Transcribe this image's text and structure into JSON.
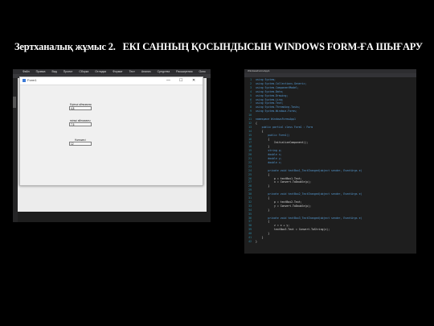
{
  "slide_title": {
    "lab": "Зертханалық жұмыс 2.",
    "main": "ЕКІ САННЫҢ ҚОСЫНДЫСЫН WINDOWS FORM-ҒА ШЫҒАРУ"
  },
  "vs_menu": [
    "Файл",
    "Правка",
    "Вид",
    "Проект",
    "Сборка",
    "Отладка",
    "Формат",
    "Тест",
    "Анализ",
    "Средства",
    "Расширения",
    "Окно",
    "Справка"
  ],
  "form1": {
    "title": "Form1",
    "min": "—",
    "max": "☐",
    "close": "✕",
    "label1": "Бірінші айнымалы",
    "value1": "4,8",
    "label2": "екінші айнымалы",
    "value2": "7,5",
    "label3": "Нәтижесі",
    "value3": "12"
  },
  "editor": {
    "tab": "WindowsFormsApp1",
    "lines": [
      {
        "n": "1",
        "t": "using System;",
        "c": "#569cd6"
      },
      {
        "n": "2",
        "t": "using System.Collections.Generic;",
        "c": "#569cd6"
      },
      {
        "n": "3",
        "t": "using System.ComponentModel;",
        "c": "#569cd6"
      },
      {
        "n": "4",
        "t": "using System.Data;",
        "c": "#569cd6"
      },
      {
        "n": "5",
        "t": "using System.Drawing;",
        "c": "#569cd6"
      },
      {
        "n": "6",
        "t": "using System.Linq;",
        "c": "#569cd6"
      },
      {
        "n": "7",
        "t": "using System.Text;",
        "c": "#569cd6"
      },
      {
        "n": "8",
        "t": "using System.Threading.Tasks;",
        "c": "#569cd6"
      },
      {
        "n": "9",
        "t": "using System.Windows.Forms;",
        "c": "#569cd6"
      },
      {
        "n": "10",
        "t": "",
        "c": "#dcdcdc"
      },
      {
        "n": "11",
        "t": "namespace WindowsFormsApp1",
        "c": "#569cd6"
      },
      {
        "n": "12",
        "t": "{",
        "c": "#dcdcdc"
      },
      {
        "n": "13",
        "t": "    public partial class Form1 : Form",
        "c": "#569cd6"
      },
      {
        "n": "14",
        "t": "    {",
        "c": "#dcdcdc"
      },
      {
        "n": "15",
        "t": "        public Form1()",
        "c": "#569cd6"
      },
      {
        "n": "16",
        "t": "        {",
        "c": "#dcdcdc"
      },
      {
        "n": "17",
        "t": "            InitializeComponent();",
        "c": "#dcdcdc"
      },
      {
        "n": "18",
        "t": "        }",
        "c": "#dcdcdc"
      },
      {
        "n": "19",
        "t": "        string p;",
        "c": "#569cd6"
      },
      {
        "n": "20",
        "t": "        double x;",
        "c": "#569cd6"
      },
      {
        "n": "21",
        "t": "        double y;",
        "c": "#569cd6"
      },
      {
        "n": "22",
        "t": "        double z;",
        "c": "#569cd6"
      },
      {
        "n": "23",
        "t": "",
        "c": "#dcdcdc"
      },
      {
        "n": "24",
        "t": "        private void textBox1_TextChanged(object sender, EventArgs e)",
        "c": "#569cd6"
      },
      {
        "n": "25",
        "t": "        {",
        "c": "#dcdcdc"
      },
      {
        "n": "26",
        "t": "            p = textBox1.Text;",
        "c": "#dcdcdc"
      },
      {
        "n": "27",
        "t": "            x = Convert.ToDouble(p);",
        "c": "#dcdcdc"
      },
      {
        "n": "28",
        "t": "        }",
        "c": "#dcdcdc"
      },
      {
        "n": "29",
        "t": "",
        "c": "#dcdcdc"
      },
      {
        "n": "30",
        "t": "        private void textBox2_TextChanged(object sender, EventArgs e)",
        "c": "#569cd6"
      },
      {
        "n": "31",
        "t": "        {",
        "c": "#dcdcdc"
      },
      {
        "n": "32",
        "t": "            p = textBox2.Text;",
        "c": "#dcdcdc"
      },
      {
        "n": "33",
        "t": "            y = Convert.ToDouble(p);",
        "c": "#dcdcdc"
      },
      {
        "n": "34",
        "t": "        }",
        "c": "#dcdcdc"
      },
      {
        "n": "35",
        "t": "",
        "c": "#dcdcdc"
      },
      {
        "n": "36",
        "t": "        private void textBox3_TextChanged(object sender, EventArgs e)",
        "c": "#569cd6"
      },
      {
        "n": "37",
        "t": "        {",
        "c": "#dcdcdc"
      },
      {
        "n": "38",
        "t": "            z = x + y;",
        "c": "#dcdcdc"
      },
      {
        "n": "39",
        "t": "            textBox3.Text = Convert.ToString(z);",
        "c": "#dcdcdc"
      },
      {
        "n": "40",
        "t": "        }",
        "c": "#dcdcdc"
      },
      {
        "n": "41",
        "t": "    }",
        "c": "#dcdcdc"
      },
      {
        "n": "42",
        "t": "}",
        "c": "#dcdcdc"
      }
    ]
  }
}
